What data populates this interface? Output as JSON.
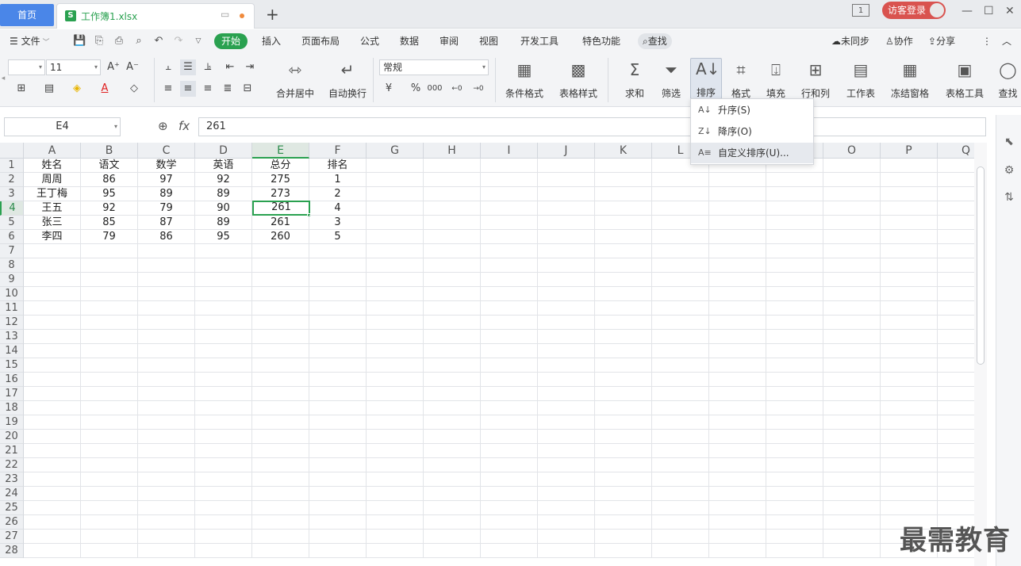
{
  "titlebar": {
    "home_tab": "首页",
    "file_tab_icon": "S",
    "file_tab": "工作簿1.xlsx",
    "page_badge": "1",
    "guest_login": "访客登录",
    "new_tab_icon": "plus-icon"
  },
  "menu": {
    "file": "文件",
    "tabs": [
      "开始",
      "插入",
      "页面布局",
      "公式",
      "数据",
      "审阅",
      "视图",
      "开发工具",
      "特色功能"
    ],
    "search": "查找",
    "unsynced": "未同步",
    "collaborate": "协作",
    "share": "分享"
  },
  "ribbon": {
    "font_size": "11",
    "number_format": "常规",
    "merge_center": "合并居中",
    "wrap_text": "自动换行",
    "cond_format": "条件格式",
    "table_style": "表格样式",
    "sum": "求和",
    "filter": "筛选",
    "sort": "排序",
    "format": "格式",
    "fill": "填充",
    "row_col": "行和列",
    "worksheet": "工作表",
    "freeze": "冻结窗格",
    "table_tools": "表格工具",
    "find": "查找"
  },
  "formula_bar": {
    "name_box": "E4",
    "fx_label": "fx",
    "value": "261"
  },
  "sheet": {
    "columns": [
      "A",
      "B",
      "C",
      "D",
      "E",
      "F",
      "G",
      "H",
      "I",
      "J",
      "K",
      "L",
      "M",
      "N",
      "O",
      "P",
      "Q"
    ],
    "rows": [
      "1",
      "2",
      "3",
      "4",
      "5",
      "6",
      "7",
      "8",
      "9",
      "10",
      "11",
      "12",
      "13",
      "14",
      "15",
      "16",
      "17",
      "18",
      "19",
      "20",
      "21",
      "22",
      "23",
      "24",
      "25",
      "26",
      "27",
      "28"
    ],
    "selected_cell": "E4",
    "data": [
      [
        "姓名",
        "语文",
        "数学",
        "英语",
        "总分",
        "排名"
      ],
      [
        "周周",
        "86",
        "97",
        "92",
        "275",
        "1"
      ],
      [
        "王丁梅",
        "95",
        "89",
        "89",
        "273",
        "2"
      ],
      [
        "王五",
        "92",
        "79",
        "90",
        "261",
        "4"
      ],
      [
        "张三",
        "85",
        "87",
        "89",
        "261",
        "3"
      ],
      [
        "李四",
        "79",
        "86",
        "95",
        "260",
        "5"
      ]
    ]
  },
  "sort_menu": {
    "items": [
      "升序(S)",
      "降序(O)",
      "自定义排序(U)..."
    ]
  },
  "watermark": "最需教育"
}
